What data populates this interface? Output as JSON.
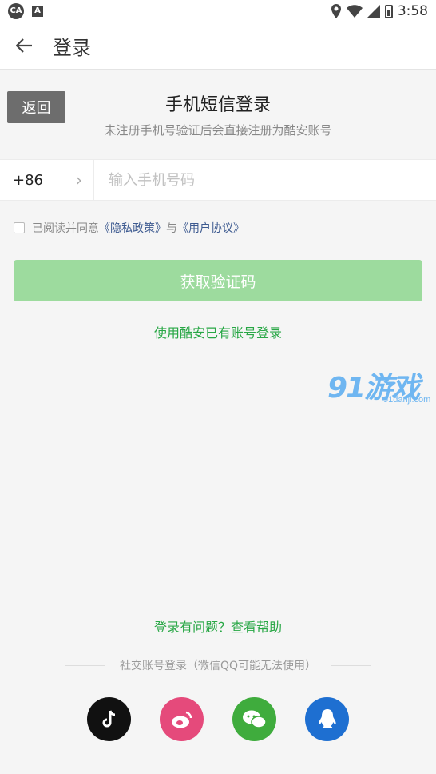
{
  "status": {
    "time": "3:58",
    "left_icon_1": "CA",
    "left_icon_2": "A"
  },
  "toolbar": {
    "title": "登录",
    "back_icon": "arrow-left-icon"
  },
  "back_button": {
    "label": "返回"
  },
  "heading": {
    "title": "手机短信登录",
    "subtitle": "未注册手机号验证后会直接注册为酷安账号"
  },
  "phone": {
    "country_code": "+86",
    "placeholder": "输入手机号码",
    "value": ""
  },
  "agreement": {
    "prefix": "已阅读并同意",
    "privacy_link": "《隐私政策》",
    "and": "与",
    "terms_link": "《用户协议》",
    "checked": false
  },
  "get_code_button": {
    "label": "获取验证码",
    "enabled": false,
    "color": "#9ddb9e"
  },
  "alt_login": {
    "label": "使用酷安已有账号登录",
    "color": "#28a745"
  },
  "watermark": {
    "main": "91游戏",
    "sub": "91danji.com"
  },
  "help": {
    "label": "登录有问题？查看帮助"
  },
  "social": {
    "title": "社交账号登录（微信QQ可能无法使用）",
    "items": [
      {
        "name": "tiktok-icon",
        "color": "#111111"
      },
      {
        "name": "weibo-icon",
        "color": "#e54a7b"
      },
      {
        "name": "wechat-icon",
        "color": "#3fac3d"
      },
      {
        "name": "qq-icon",
        "color": "#1e6fd1"
      }
    ]
  }
}
